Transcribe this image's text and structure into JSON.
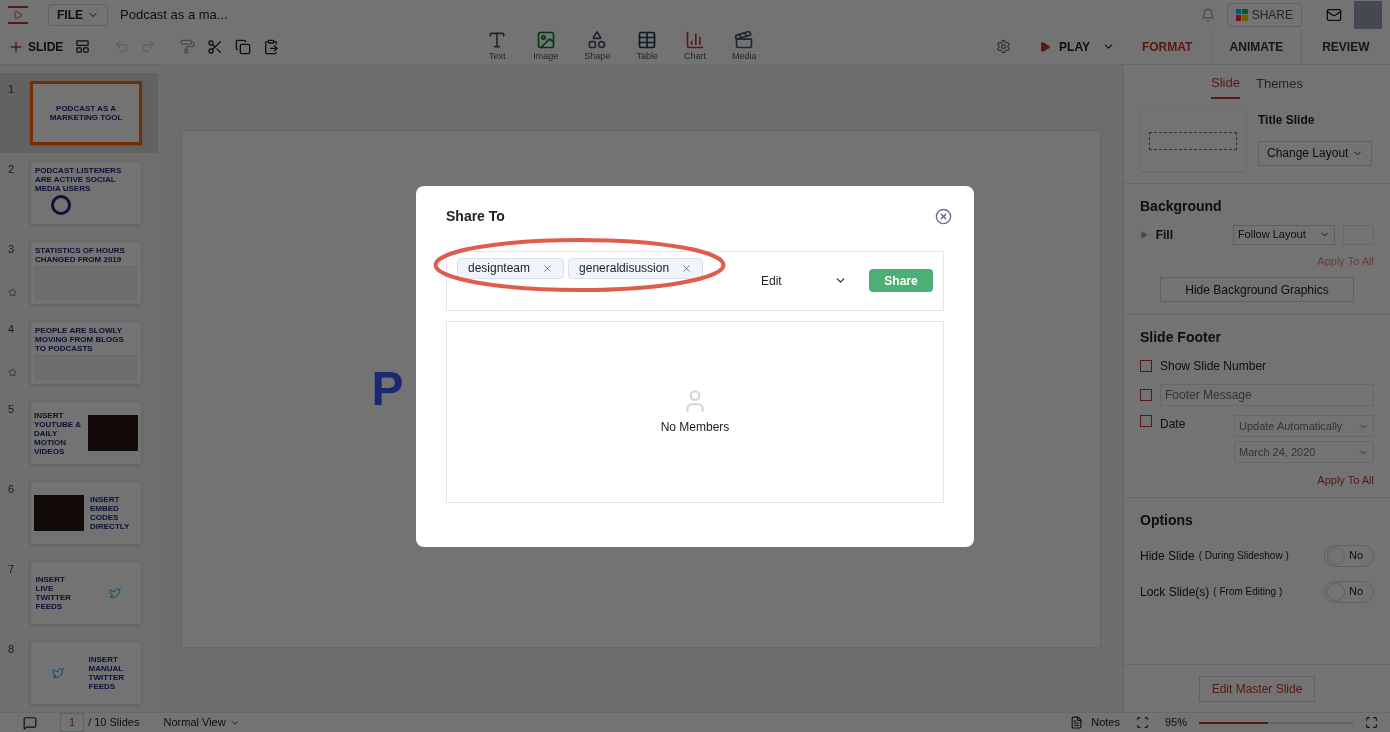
{
  "app": {
    "file_menu": "FILE",
    "title": "Podcast as a ma..."
  },
  "toolbar": {
    "new_slide": "SLIDE",
    "play": "PLAY",
    "insert": [
      {
        "kind": "text",
        "label": "Text"
      },
      {
        "kind": "image",
        "label": "Image"
      },
      {
        "kind": "shape",
        "label": "Shape"
      },
      {
        "kind": "table",
        "label": "Table"
      },
      {
        "kind": "chart",
        "label": "Chart"
      },
      {
        "kind": "media",
        "label": "Media"
      }
    ]
  },
  "header": {
    "share": "SHARE"
  },
  "panel_tabs": [
    {
      "label": "FORMAT",
      "selected": true
    },
    {
      "label": "ANIMATE",
      "selected": false
    },
    {
      "label": "REVIEW",
      "selected": false
    }
  ],
  "sub_tabs": [
    {
      "label": "Slide",
      "selected": true
    },
    {
      "label": "Themes",
      "selected": false
    }
  ],
  "layout": {
    "name": "Title Slide",
    "button": "Change Layout"
  },
  "background": {
    "heading": "Background",
    "fill_label": "Fill",
    "fill_value": "Follow Layout",
    "apply": {
      "label": "Apply To All",
      "disabled": true
    },
    "hide_button": "Hide Background Graphics"
  },
  "footer": {
    "heading": "Slide Footer",
    "items": [
      {
        "kind": "check",
        "label": "Show Slide Number",
        "checked": false
      },
      {
        "kind": "field",
        "placeholder": "Footer Message",
        "checked": false
      },
      {
        "kind": "date",
        "label": "Date",
        "checked": false,
        "selects": [
          "Update Automatically",
          "March 24, 2020"
        ]
      }
    ],
    "apply": {
      "label": "Apply To All",
      "disabled": false
    }
  },
  "options": {
    "heading": "Options",
    "items": [
      {
        "label": "Hide Slide",
        "note": "( During Slideshow )",
        "value": "No",
        "on": false
      },
      {
        "label": "Lock Slide(s)",
        "note": "( From Editing )",
        "value": "No",
        "on": false
      }
    ]
  },
  "edit_master": "Edit Master Slide",
  "slides": [
    {
      "number": "1",
      "title": "PODCAST AS A MARKETING TOOL",
      "kind": "title",
      "selected": true,
      "animated": false
    },
    {
      "number": "2",
      "title": "PODCAST LISTENERS ARE ACTIVE SOCIAL MEDIA USERS",
      "kind": "donut",
      "selected": false,
      "animated": false
    },
    {
      "number": "3",
      "title": "STATISTICS OF HOURS CHANGED FROM 2019",
      "kind": "table",
      "selected": false,
      "animated": true
    },
    {
      "number": "4",
      "title": "PEOPLE ARE SLOWLY MOVING FROM BLOGS TO PODCASTS",
      "kind": "line",
      "selected": false,
      "animated": true
    },
    {
      "number": "5",
      "title": "INSERT YOUTUBE & DAILY MOTION VIDEOS",
      "kind": "photo_right",
      "selected": false,
      "animated": false
    },
    {
      "number": "6",
      "title": "INSERT EMBED CODES DIRECTLY",
      "kind": "photo_left",
      "selected": false,
      "animated": false
    },
    {
      "number": "7",
      "title": "INSERT LIVE TWITTER FEEDS",
      "kind": "bird_right",
      "selected": false,
      "animated": false
    },
    {
      "number": "8",
      "title": "INSERT MANUAL TWITTER FEEDS",
      "kind": "bird_left",
      "selected": false,
      "animated": false
    }
  ],
  "main_slide": {
    "title": "P"
  },
  "status_bar": {
    "page": "1",
    "total": "/ 10 Slides",
    "view": "Normal View",
    "notes": "Notes",
    "zoom": "95%",
    "level": 0.45
  },
  "dialog": {
    "title": "Share To",
    "recipients": [
      {
        "label": "designteam"
      },
      {
        "label": "generaldisussion"
      }
    ],
    "permission": "Edit",
    "share": "Share",
    "empty": "No Members"
  }
}
